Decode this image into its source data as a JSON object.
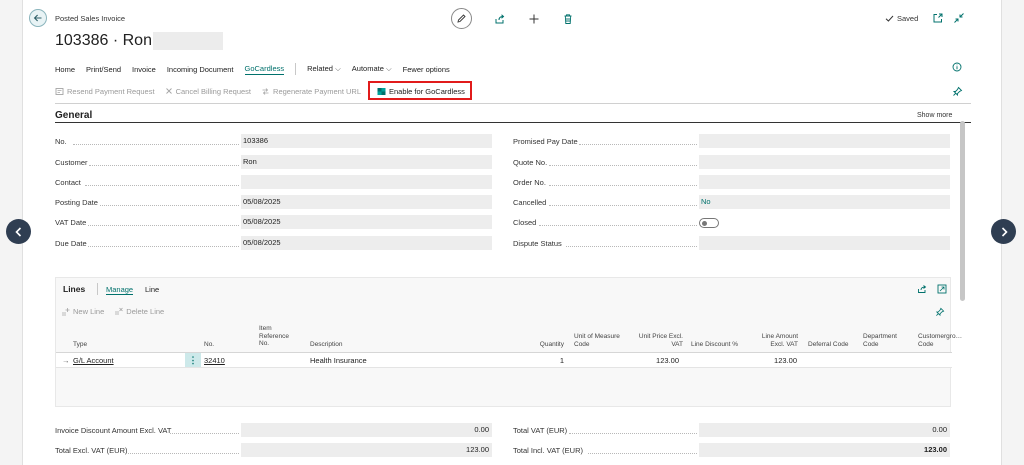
{
  "page": {
    "kind": "Posted Sales Invoice",
    "title": "103386 · Ron",
    "status": "Saved"
  },
  "tabs": [
    {
      "label": "Home",
      "active": false
    },
    {
      "label": "Print/Send",
      "active": false
    },
    {
      "label": "Invoice",
      "active": false
    },
    {
      "label": "Incoming Document",
      "active": false
    },
    {
      "label": "GoCardless",
      "active": true
    },
    {
      "label": "Related",
      "active": false,
      "dropdown": true
    },
    {
      "label": "Automate",
      "active": false,
      "dropdown": true
    },
    {
      "label": "Fewer options",
      "active": false
    }
  ],
  "gocardless_actions": [
    {
      "label": "Resend Payment Request",
      "enabled": false,
      "icon": "resend-icon"
    },
    {
      "label": "Cancel Billing Request",
      "enabled": false,
      "icon": "close-icon"
    },
    {
      "label": "Regenerate Payment URL",
      "enabled": false,
      "icon": "regenerate-icon"
    },
    {
      "label": "Enable for GoCardless",
      "enabled": true,
      "icon": "gocardless-icon",
      "highlighted": true
    }
  ],
  "general": {
    "title": "General",
    "show_more": "Show more",
    "left_fields": [
      {
        "label": "No.",
        "value": "103386"
      },
      {
        "label": "Customer",
        "value": "Ron"
      },
      {
        "label": "Contact",
        "value": ""
      },
      {
        "label": "Posting Date",
        "value": "05/08/2025"
      },
      {
        "label": "VAT Date",
        "value": "05/08/2025"
      },
      {
        "label": "Due Date",
        "value": "05/08/2025"
      }
    ],
    "right_fields": [
      {
        "label": "Promised Pay Date",
        "value": ""
      },
      {
        "label": "Quote No.",
        "value": ""
      },
      {
        "label": "Order No.",
        "value": ""
      },
      {
        "label": "Cancelled",
        "value": "No"
      },
      {
        "label": "Closed",
        "value": ""
      },
      {
        "label": "Dispute Status",
        "value": ""
      }
    ]
  },
  "lines": {
    "title": "Lines",
    "tabs": [
      "Manage",
      "Line"
    ],
    "actions": [
      {
        "label": "New Line",
        "enabled": false
      },
      {
        "label": "Delete Line",
        "enabled": false
      }
    ],
    "columns": {
      "type": "Type",
      "no": "No.",
      "item_ref": "Item Reference No.",
      "description": "Description",
      "quantity": "Quantity",
      "uom": "Unit of Measure Code",
      "unit_price": "Unit Price Excl. VAT",
      "line_discount": "Line Discount %",
      "line_amount": "Line Amount Excl. VAT",
      "deferral": "Deferral Code",
      "department": "Department Code",
      "customergroup": "Customergro… Code"
    },
    "rows": [
      {
        "type": "G/L Account",
        "no": "32410",
        "item_ref": "",
        "description": "Health Insurance",
        "quantity": "1",
        "uom": "",
        "unit_price": "123.00",
        "line_discount": "",
        "line_amount": "123.00",
        "deferral": "",
        "department": "",
        "customergroup": ""
      }
    ]
  },
  "totals": {
    "left": [
      {
        "label": "Invoice Discount Amount Excl. VAT",
        "value": "0.00"
      },
      {
        "label": "Total Excl. VAT (EUR)",
        "value": "123.00"
      }
    ],
    "right": [
      {
        "label": "Total VAT (EUR)",
        "value": "0.00"
      },
      {
        "label": "Total Incl. VAT (EUR)",
        "value": "123.00"
      }
    ]
  },
  "colors": {
    "accent": "#00716c",
    "highlight_border": "#e11b1b",
    "nav_button": "#2f3e52"
  }
}
